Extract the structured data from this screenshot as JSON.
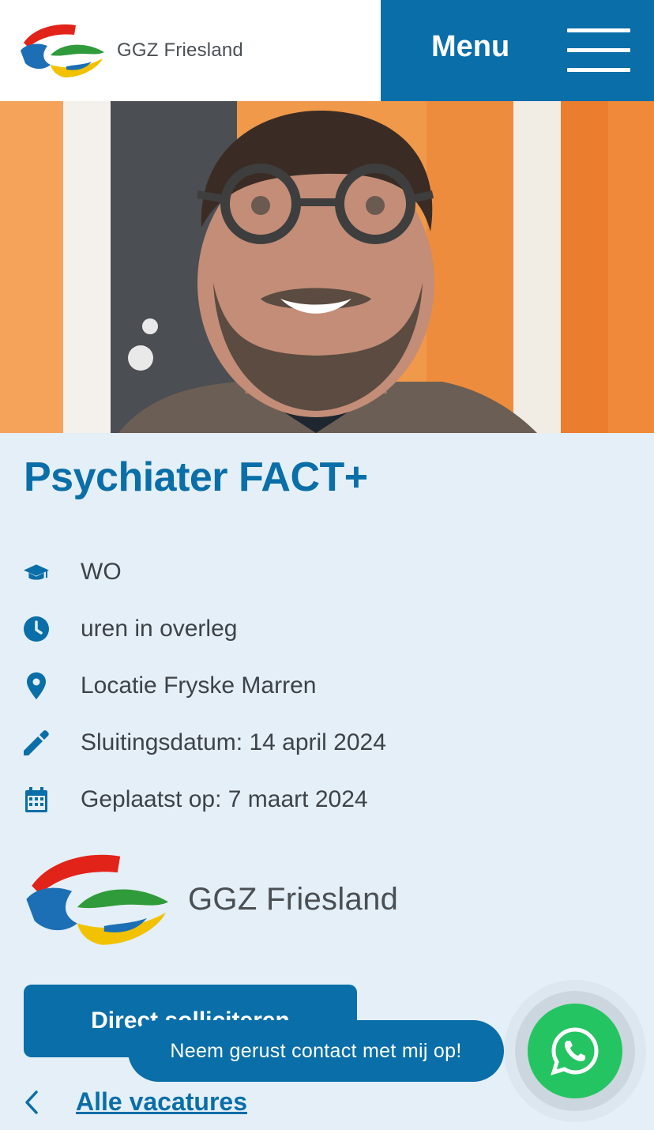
{
  "header": {
    "brand_name": "GGZ Friesland",
    "menu_label": "Menu"
  },
  "vacancy": {
    "title": "Psychiater FACT+",
    "details": [
      {
        "icon": "graduation-cap-icon",
        "text": "WO"
      },
      {
        "icon": "clock-icon",
        "text": "uren in overleg"
      },
      {
        "icon": "location-pin-icon",
        "text": "Locatie Fryske Marren"
      },
      {
        "icon": "pencil-icon",
        "text": "Sluitingsdatum: 14 april 2024"
      },
      {
        "icon": "calendar-icon",
        "text": "Geplaatst op: 7 maart 2024"
      }
    ]
  },
  "employer_logo": {
    "name": "GGZ Friesland"
  },
  "actions": {
    "apply_label": "Direct solliciteren",
    "back_label": "Alle vacatures"
  },
  "contact": {
    "bubble_text": "Neem gerust contact met mij op!",
    "whatsapp_icon": "whatsapp-icon"
  },
  "colors": {
    "primary": "#0a6ea8",
    "background": "#e4eff7",
    "whatsapp": "#25c462"
  }
}
